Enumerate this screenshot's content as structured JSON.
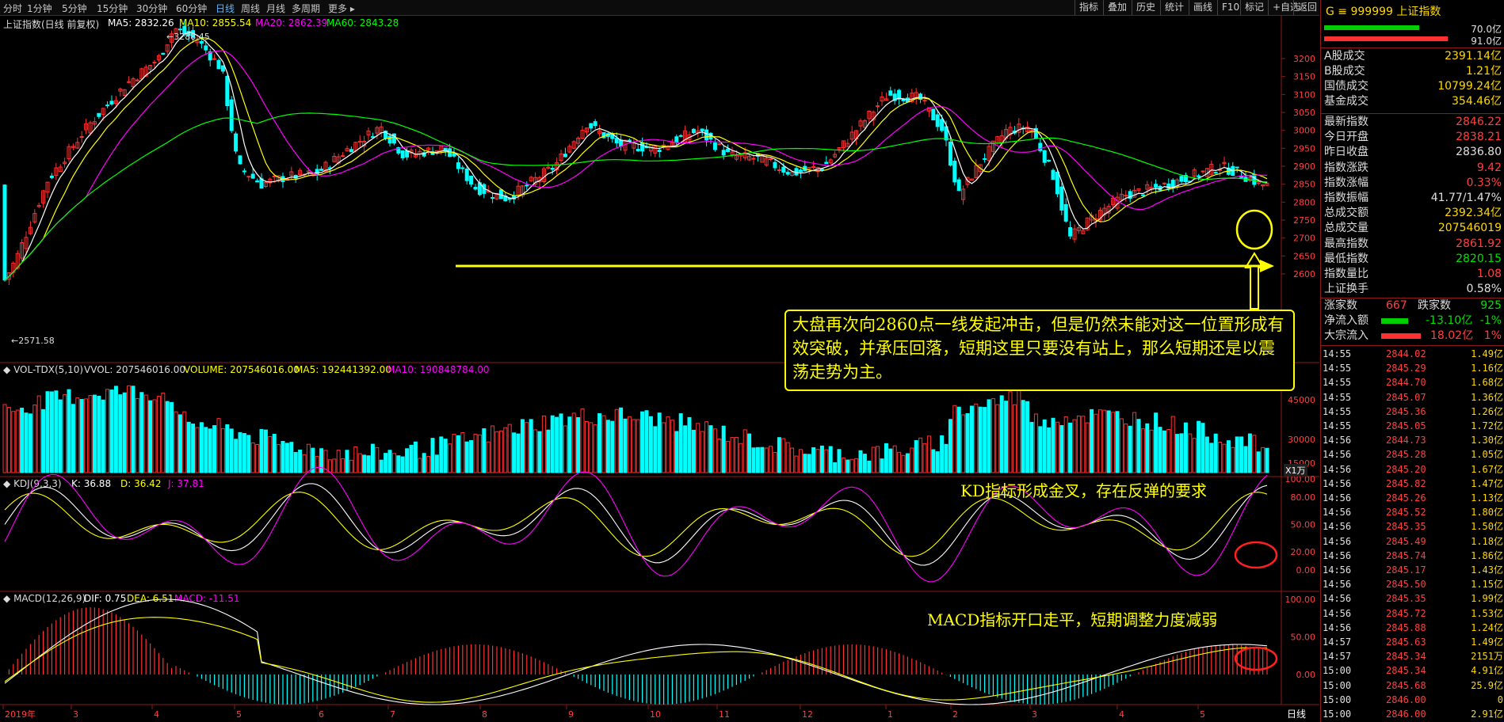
{
  "toolbar": {
    "periods": [
      "分时",
      "1分钟",
      "5分钟",
      "15分钟",
      "30分钟",
      "60分钟",
      "日线",
      "周线",
      "月线",
      "多周期",
      "更多 ▸"
    ],
    "active_period": "日线",
    "right_buttons": [
      "指标",
      "叠加",
      "历史",
      "统计",
      "画线",
      "F10",
      "标记",
      "+自选",
      "返回"
    ]
  },
  "price_panel": {
    "title": "上证指数(日线 前复权)",
    "ma5": "MA5: 2832.26",
    "ma10": "MA10: 2855.54",
    "ma20": "MA20: 2862.39",
    "ma60": "MA60: 2843.28",
    "high_marker": "3288.45",
    "low_marker": "2571.58",
    "y_ticks": [
      "3200",
      "3150",
      "3100",
      "3050",
      "3000",
      "2950",
      "2900",
      "2850",
      "2800",
      "2750",
      "2700",
      "2650",
      "2600"
    ]
  },
  "volume_panel": {
    "title": "VOL-TDX(5,10)",
    "vvol": "VVOL: 207546016.00",
    "volume": "VOLUME: 207546016.00",
    "ma5": "MA5: 192441392.00",
    "ma10": "MA10: 190848784.00",
    "y_ticks": [
      "45000",
      "30000",
      "15000"
    ],
    "unit": "X1万"
  },
  "kdj_panel": {
    "title": "KDJ(9,3,3)",
    "k": "K: 36.88",
    "d": "D: 36.42",
    "j": "J: 37.81",
    "y_ticks": [
      "100.00",
      "80.00",
      "50.00",
      "20.00",
      "0.00"
    ],
    "note": "KD指标形成金叉，存在反弹的要求"
  },
  "macd_panel": {
    "title": "MACD(12,26,9)",
    "dif": "DIF: 0.75",
    "dea": "DEA: 6.51",
    "macd": "MACD: -11.51",
    "y_ticks": [
      "100.00",
      "50.00",
      "0.00"
    ],
    "note": "MACD指标开口走平，短期调整力度减弱"
  },
  "x_axis": {
    "labels": [
      "2019年",
      "3",
      "4",
      "5",
      "6",
      "7",
      "8",
      "9",
      "10",
      "11",
      "12",
      "1",
      "2",
      "3",
      "4",
      "5"
    ],
    "period_label": "日线"
  },
  "annotation": {
    "text": "大盘再次向2860点一线发起冲击，但是仍然未能对这一位置形成有效突破，并承压回落，短期这里只要没有站上，那么短期还是以震荡走势为主。"
  },
  "right_panel": {
    "code": "G ≡ 999999 上证指数",
    "bar_values": [
      "70.0亿",
      "91.0亿"
    ],
    "turnover": [
      {
        "label": "A股成交",
        "value": "2391.14亿",
        "color": "#ffd800"
      },
      {
        "label": "B股成交",
        "value": "1.21亿",
        "color": "#ffd800"
      },
      {
        "label": "国债成交",
        "value": "10799.24亿",
        "color": "#ffd800"
      },
      {
        "label": "基金成交",
        "value": "354.46亿",
        "color": "#ffd800"
      }
    ],
    "stats": [
      {
        "label": "最新指数",
        "value": "2846.22",
        "color": "#ff4040"
      },
      {
        "label": "今日开盘",
        "value": "2838.21",
        "color": "#ff4040"
      },
      {
        "label": "昨日收盘",
        "value": "2836.80",
        "color": "#e0e0e0"
      },
      {
        "label": "指数涨跌",
        "value": "9.42",
        "color": "#ff4040"
      },
      {
        "label": "指数涨幅",
        "value": "0.33%",
        "color": "#ff4040"
      },
      {
        "label": "指数振幅",
        "value": "41.77/1.47%",
        "color": "#e0e0e0"
      },
      {
        "label": "总成交额",
        "value": "2392.34亿",
        "color": "#ffd800"
      },
      {
        "label": "总成交量",
        "value": "207546019",
        "color": "#ffd800"
      },
      {
        "label": "最高指数",
        "value": "2861.92",
        "color": "#ff4040"
      },
      {
        "label": "最低指数",
        "value": "2820.15",
        "color": "#00e000"
      },
      {
        "label": "指数量比",
        "value": "1.08",
        "color": "#ff4040"
      },
      {
        "label": "上证换手",
        "value": "0.58%",
        "color": "#e0e0e0"
      }
    ],
    "up_label": "涨家数",
    "up_count": "667",
    "down_label": "跌家数",
    "down_count": "925",
    "net_inflow_label": "净流入额",
    "net_inflow": "-13.10亿",
    "net_inflow_pct": "-1%",
    "block_inflow_label": "大宗流入",
    "block_inflow": "18.02亿",
    "block_inflow_pct": "1%",
    "ticks": [
      {
        "time": "14:55",
        "price": "2844.02",
        "vol": "1.49亿"
      },
      {
        "time": "14:55",
        "price": "2845.29",
        "vol": "1.16亿"
      },
      {
        "time": "14:55",
        "price": "2844.70",
        "vol": "1.68亿"
      },
      {
        "time": "14:55",
        "price": "2845.07",
        "vol": "1.36亿"
      },
      {
        "time": "14:55",
        "price": "2845.36",
        "vol": "1.26亿"
      },
      {
        "time": "14:55",
        "price": "2845.05",
        "vol": "1.72亿"
      },
      {
        "time": "14:56",
        "price": "2844.73",
        "vol": "1.30亿"
      },
      {
        "time": "14:56",
        "price": "2845.28",
        "vol": "1.05亿"
      },
      {
        "time": "14:56",
        "price": "2845.20",
        "vol": "1.67亿"
      },
      {
        "time": "14:56",
        "price": "2845.82",
        "vol": "1.47亿"
      },
      {
        "time": "14:56",
        "price": "2845.26",
        "vol": "1.13亿"
      },
      {
        "time": "14:56",
        "price": "2845.52",
        "vol": "1.80亿"
      },
      {
        "time": "14:56",
        "price": "2845.35",
        "vol": "1.50亿"
      },
      {
        "time": "14:56",
        "price": "2845.49",
        "vol": "1.18亿"
      },
      {
        "time": "14:56",
        "price": "2845.74",
        "vol": "1.86亿"
      },
      {
        "time": "14:56",
        "price": "2845.17",
        "vol": "1.43亿"
      },
      {
        "time": "14:56",
        "price": "2845.50",
        "vol": "1.15亿"
      },
      {
        "time": "14:56",
        "price": "2845.35",
        "vol": "1.99亿"
      },
      {
        "time": "14:56",
        "price": "2845.72",
        "vol": "1.53亿"
      },
      {
        "time": "14:56",
        "price": "2845.88",
        "vol": "1.24亿"
      },
      {
        "time": "14:57",
        "price": "2845.63",
        "vol": "1.49亿"
      },
      {
        "time": "14:57",
        "price": "2845.34",
        "vol": "2151万"
      },
      {
        "time": "15:00",
        "price": "2845.34",
        "vol": "4.91亿"
      },
      {
        "time": "15:00",
        "price": "2845.68",
        "vol": "25.9亿"
      },
      {
        "time": "15:00",
        "price": "2846.00",
        "vol": "0"
      },
      {
        "time": "15:00",
        "price": "2846.00",
        "vol": "2.91亿"
      }
    ]
  },
  "colors": {
    "up": "#ff3030",
    "down": "#00ffff",
    "ma5": "#ffffff",
    "ma10": "#ffff00",
    "ma20": "#ff00ff",
    "ma60": "#00ff00",
    "annotation": "#ffff00"
  }
}
